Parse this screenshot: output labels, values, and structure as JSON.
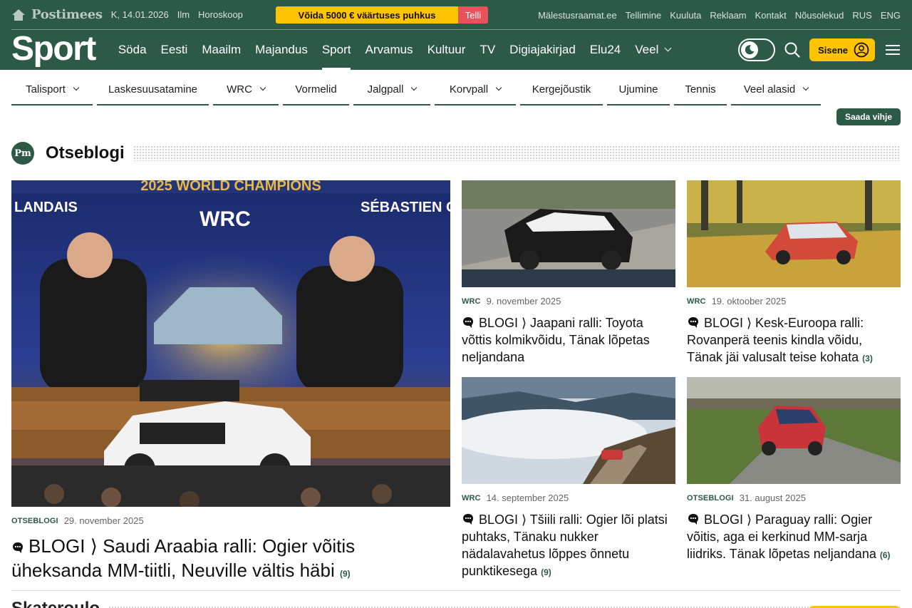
{
  "top": {
    "brand": "Postimees",
    "date": "K, 14.01.2026",
    "weather": "Ilm",
    "horoscope": "Horoskoop",
    "promo_text": "Võida 5000 € väärtuses puhkus",
    "promo_button": "Telli",
    "links": [
      "Mälestusraamat.ee",
      "Tellimine",
      "Kuuluta",
      "Reklaam",
      "Kontakt",
      "Nõusolekud",
      "RUS",
      "ENG"
    ]
  },
  "nav": {
    "logo": "Sport",
    "items": [
      "Söda",
      "Eesti",
      "Maailm",
      "Majandus",
      "Sport",
      "Arvamus",
      "Kultuur",
      "TV",
      "Digiajakirjad",
      "Elu24",
      "Veel"
    ],
    "signin": "Sisene"
  },
  "subnav": {
    "items": [
      {
        "label": "Talisport",
        "dropdown": true
      },
      {
        "label": "Laskesuusatamine",
        "dropdown": false
      },
      {
        "label": "WRC",
        "dropdown": true
      },
      {
        "label": "Vormelid",
        "dropdown": false
      },
      {
        "label": "Jalgpall",
        "dropdown": true
      },
      {
        "label": "Korvpall",
        "dropdown": true
      },
      {
        "label": "Kergejõustik",
        "dropdown": false
      },
      {
        "label": "Ujumine",
        "dropdown": false
      },
      {
        "label": "Tennis",
        "dropdown": false
      },
      {
        "label": "Veel alasid",
        "dropdown": true
      }
    ],
    "tip_button": "Saada vihje"
  },
  "section": {
    "logo_text": "Pm",
    "title": "Otseblogi"
  },
  "articles": [
    {
      "category": "OTSEBLOGI",
      "date": "29. november 2025",
      "headline": "BLOGI ⟩ Saudi Araabia ralli: Ogier võitis üheksanda MM-tiitli, Neuville vältis häbi",
      "count": "(9)"
    },
    {
      "category": "WRC",
      "date": "9. november 2025",
      "headline": "BLOGI ⟩ Jaapani ralli: Toyota võttis kolmikvõidu, Tänak lõpetas neljandana",
      "count": ""
    },
    {
      "category": "WRC",
      "date": "19. oktoober 2025",
      "headline": "BLOGI ⟩ Kesk-Euroopa ralli: Rovanperä teenis kindla võidu, Tänak jäi valusalt teise kohata",
      "count": "(3)"
    },
    {
      "category": "WRC",
      "date": "14. september 2025",
      "headline": "BLOGI ⟩ Tšiili ralli: Ogier lõi platsi puhtaks, Tänaku nukker nädalavahetus lõppes õnnetu punktikesega",
      "count": "(9)"
    },
    {
      "category": "OTSEBLOGI",
      "date": "31. august 2025",
      "headline": "BLOGI ⟩ Paraguay ralli: Ogier võitis, aga ei kerkinud MM-sarja liidriks. Tänak lõpetas neljandana",
      "count": "(6)"
    }
  ],
  "big_image": {
    "banner": "2025 WORLD CHAMPIONS",
    "driver_left": "LANDAIS",
    "driver_right": "SÉBASTIEN O",
    "wrc_logo": "WRC"
  },
  "next_section": {
    "title": "Skateroulo"
  },
  "colors": {
    "brand_green": "#2d5947",
    "accent_yellow": "#ffc300",
    "promo_red": "#e8525b"
  }
}
